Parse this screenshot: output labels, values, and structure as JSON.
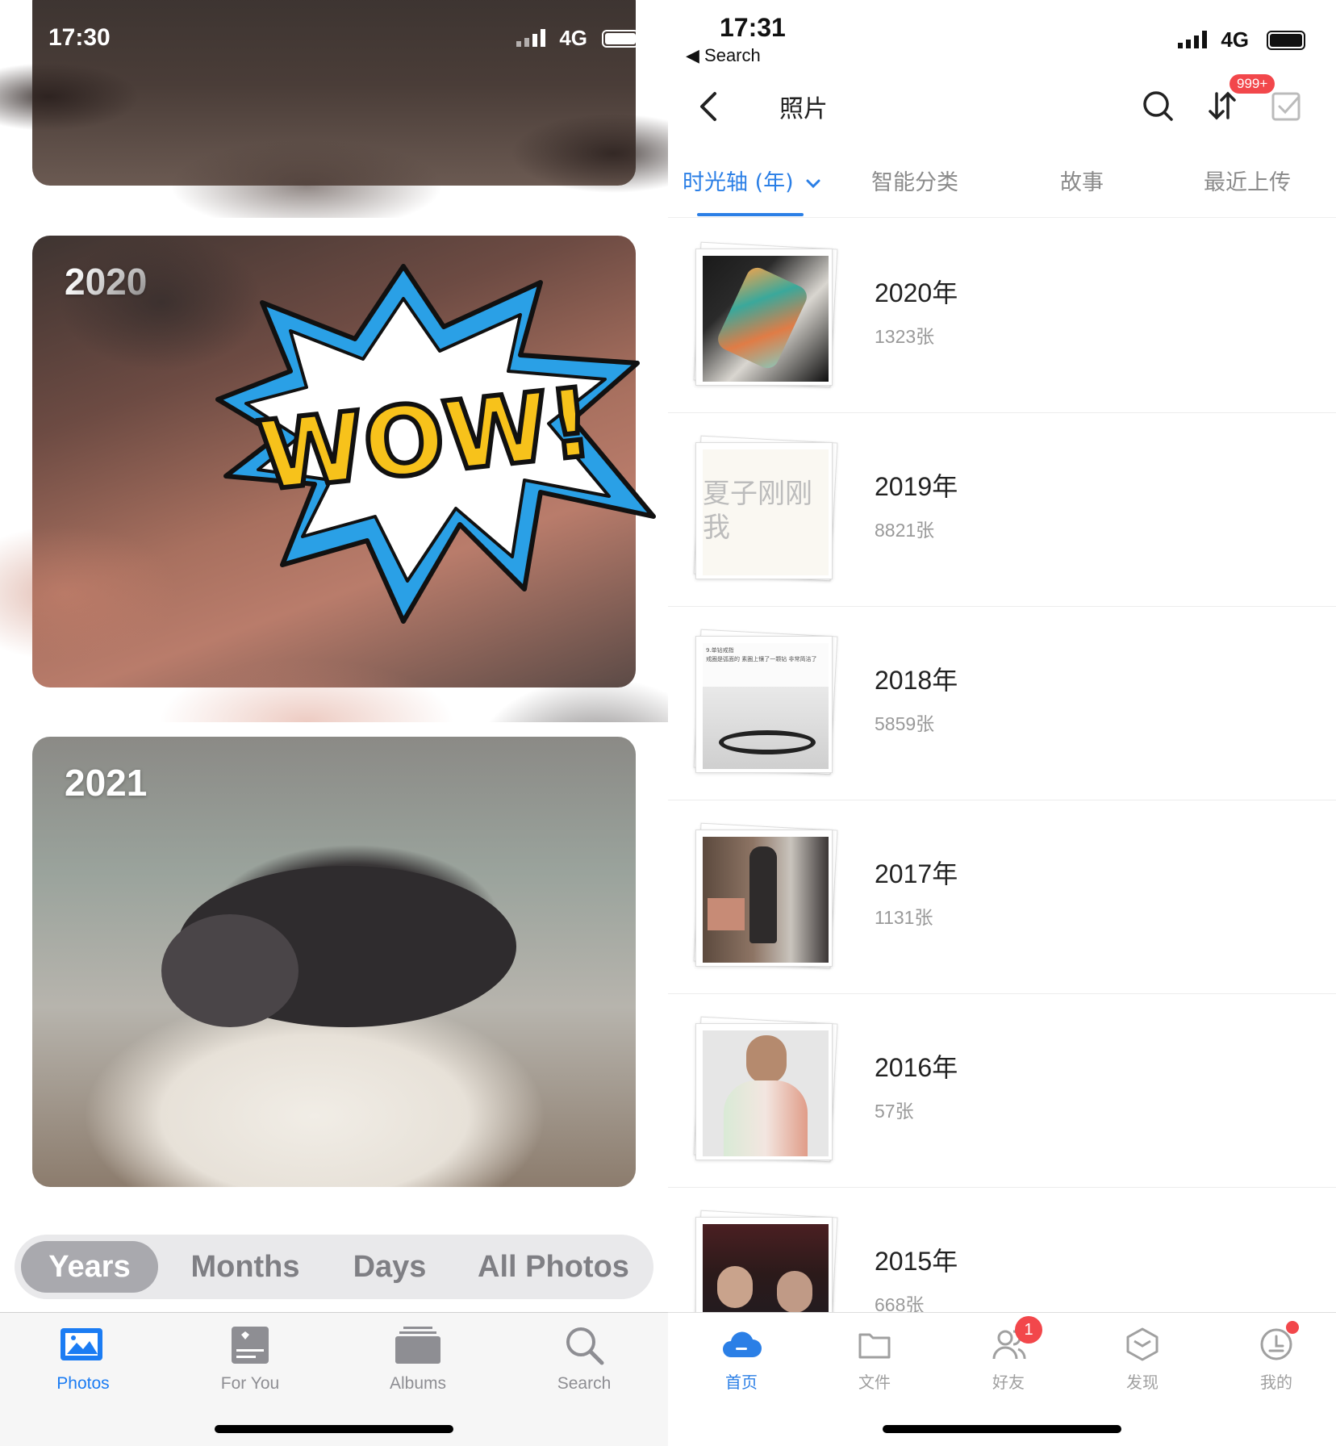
{
  "left": {
    "status": {
      "time": "17:30",
      "network": "4G"
    },
    "cards": [
      {
        "year": ""
      },
      {
        "year": "2020"
      },
      {
        "year": "2021"
      }
    ],
    "sticker_text": "WOW!",
    "segments": [
      "Years",
      "Months",
      "Days",
      "All Photos"
    ],
    "active_segment": "Years",
    "tabs": [
      {
        "label": "Photos",
        "icon": "photos-icon"
      },
      {
        "label": "For You",
        "icon": "for-you-icon"
      },
      {
        "label": "Albums",
        "icon": "albums-icon"
      },
      {
        "label": "Search",
        "icon": "search-icon"
      }
    ],
    "active_tab": "Photos",
    "accent": "#1b7cf3"
  },
  "right": {
    "status": {
      "time": "17:31",
      "network": "4G",
      "back_app": "◀ Search"
    },
    "title": "照片",
    "badge": "999+",
    "tabs": [
      {
        "label": "时光轴 (年)",
        "icon": "chevron-down-icon"
      },
      {
        "label": "智能分类"
      },
      {
        "label": "故事"
      },
      {
        "label": "最近上传"
      }
    ],
    "active_tab": "时光轴 (年)",
    "years": [
      {
        "year": "2020年",
        "count": "1323张"
      },
      {
        "year": "2019年",
        "count": "8821张"
      },
      {
        "year": "2018年",
        "count": "5859张"
      },
      {
        "year": "2017年",
        "count": "1131张"
      },
      {
        "year": "2016年",
        "count": "57张"
      },
      {
        "year": "2015年",
        "count": "668张"
      }
    ],
    "thumb_text": {
      "y2019": "夏子刚刚 我",
      "y2018_line1": "9.单钻戒指",
      "y2018_line2": "戒圈是弧面的 素圈上镶了一颗钻 非常简洁了"
    },
    "bottom_tabs": [
      {
        "label": "首页",
        "icon": "cloud-home-icon"
      },
      {
        "label": "文件",
        "icon": "folder-icon"
      },
      {
        "label": "好友",
        "icon": "friends-icon"
      },
      {
        "label": "发现",
        "icon": "discover-icon"
      },
      {
        "label": "我的",
        "icon": "profile-icon"
      }
    ],
    "friends_badge": "1",
    "accent": "#2b7fe6"
  }
}
